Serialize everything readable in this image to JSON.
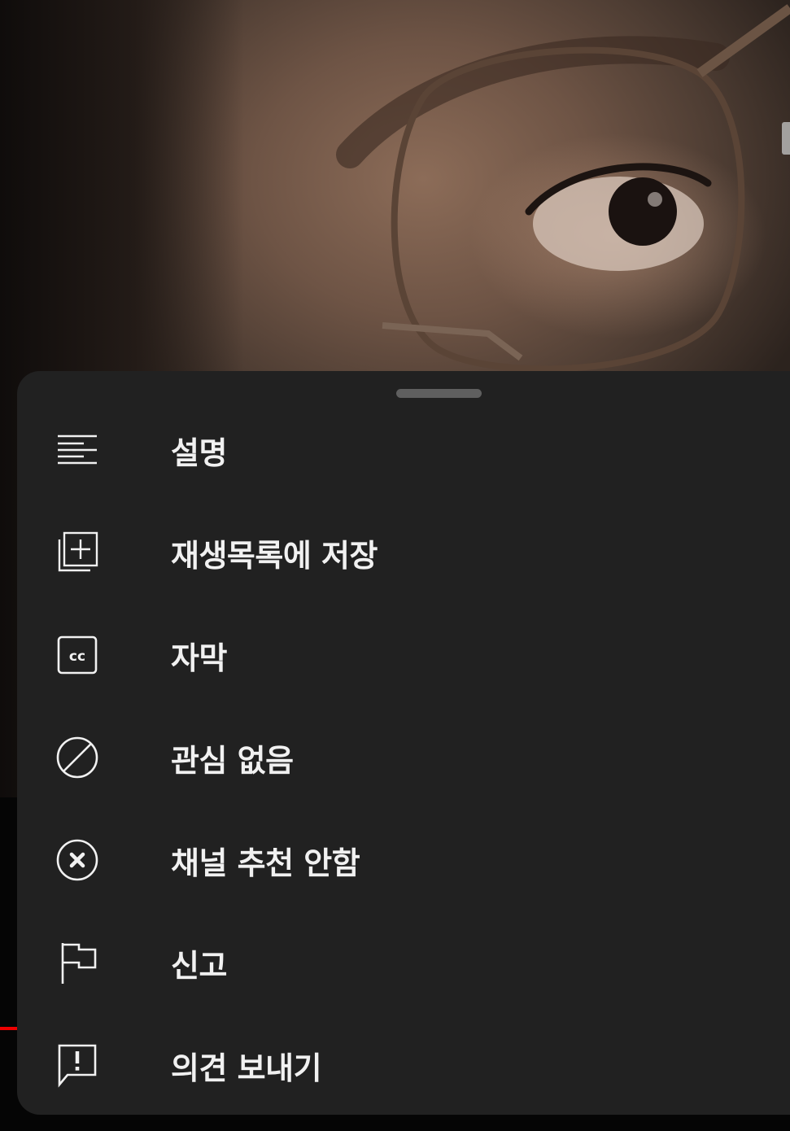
{
  "sheet": {
    "items": [
      {
        "label": "설명",
        "icon": "description-lines-icon"
      },
      {
        "label": "재생목록에 저장",
        "icon": "playlist-add-icon"
      },
      {
        "label": "자막",
        "icon": "closed-captions-icon"
      },
      {
        "label": "관심 없음",
        "icon": "not-interested-icon"
      },
      {
        "label": "채널 추천 안함",
        "icon": "circle-x-icon"
      },
      {
        "label": "신고",
        "icon": "flag-icon"
      },
      {
        "label": "의견 보내기",
        "icon": "feedback-icon"
      }
    ]
  },
  "colors": {
    "sheet_background": "#212121",
    "text": "#f1f1f1",
    "handle": "#5f5f5f",
    "progress": "#e00000"
  }
}
